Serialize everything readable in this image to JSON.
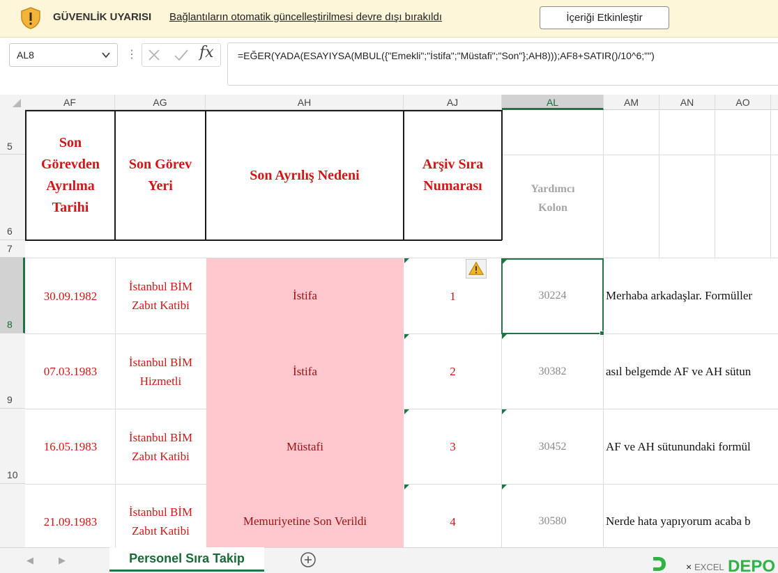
{
  "security_bar": {
    "title": "GÜVENLİK UYARISI",
    "message": "Bağlantıların otomatik güncelleştirilmesi devre dışı bırakıldı",
    "button": "İçeriği Etkinleştir"
  },
  "formula_bar": {
    "name_box": "AL8",
    "dots": "⋮",
    "fx": "fx",
    "formula": "=EĞER(YADA(ESAYIYSA(MBUL({\"Emekli\";\"İstifa\";\"Müstafi\";\"Son\"};AH8)));AF8+SATIR()/10^6;\"\")"
  },
  "columns": [
    "AF",
    "AG",
    "AH",
    "AJ",
    "AL",
    "AM",
    "AN",
    "AO"
  ],
  "selected_column": "AL",
  "rows": [
    "5",
    "6",
    "7",
    "8",
    "9",
    "10"
  ],
  "selected_row": "8",
  "headers": {
    "af": [
      "Son",
      "Görevden",
      "Ayrılma",
      "Tarihi"
    ],
    "ag": [
      "Son Görev",
      "Yeri"
    ],
    "ah": "Son Ayrılış Nedeni",
    "aj": [
      "Arşiv Sıra",
      "Numarası"
    ],
    "al": [
      "Yardımcı",
      "Kolon"
    ]
  },
  "data_rows": [
    {
      "date": "30.09.1982",
      "place": [
        "İstanbul BİM",
        "Zabıt Katibi"
      ],
      "reason": "İstifa",
      "no": "1",
      "helper": "30224",
      "note": "Merhaba arkadaşlar. Formüller"
    },
    {
      "date": "07.03.1983",
      "place": [
        "İstanbul BİM",
        "Hizmetli"
      ],
      "reason": "İstifa",
      "no": "2",
      "helper": "30382",
      "note": "asıl belgemde AF ve AH sütun"
    },
    {
      "date": "16.05.1983",
      "place": [
        "İstanbul BİM",
        "Zabıt Katibi"
      ],
      "reason": "Müstafi",
      "no": "3",
      "helper": "30452",
      "note": "AF ve AH sütunundaki formül"
    },
    {
      "date": "21.09.1983",
      "place": [
        "İstanbul BİM",
        "Zabıt Katibi"
      ],
      "reason": "Memuriyetine Son Verildi",
      "no": "4",
      "helper": "30580",
      "note": "Nerde hata yapıyorum acaba b"
    }
  ],
  "sheet_tab": "Personel Sıra Takip",
  "colors": {
    "accent": "#217346",
    "header_red": "#d01616",
    "reason_fill": "#ffc7ce",
    "security_bg": "#fdf6d8"
  }
}
